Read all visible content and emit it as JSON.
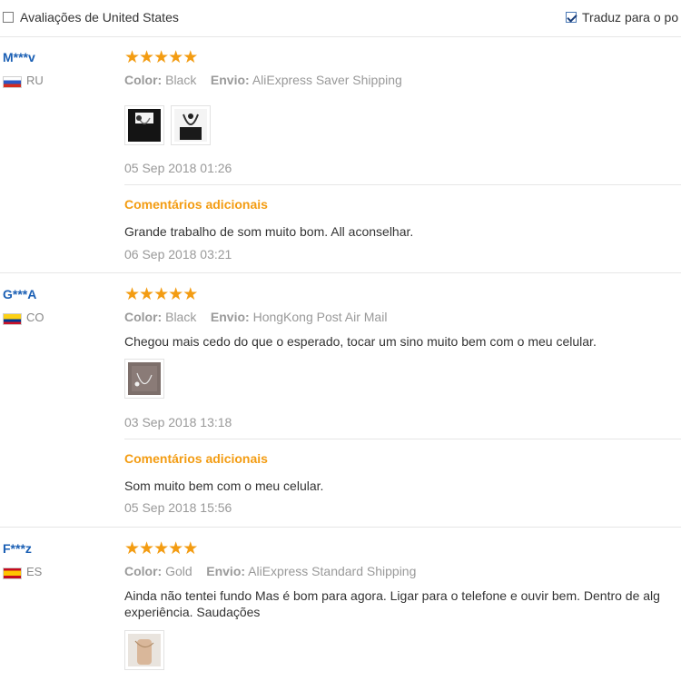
{
  "topbar": {
    "reviews_filter_label": "Avaliações de United States",
    "reviews_filter_checked": false,
    "translate_label": "Traduz para o po",
    "translate_checked": true
  },
  "reviews": [
    {
      "user": "M***v",
      "country": "RU",
      "flag": "russia-flag-icon",
      "stars": 5,
      "color_label": "Color:",
      "color_value": "Black",
      "shipping_label": "Envio:",
      "shipping_value": "AliExpress Saver Shipping",
      "text": "",
      "photos": [
        "review-photo-earphones-1",
        "review-photo-earphones-2"
      ],
      "date": "05 Sep 2018 01:26",
      "additional_heading": "Comentários adicionais",
      "additional_text": "Grande trabalho de som muito bom. All aconselhar.",
      "additional_date": "06 Sep 2018 03:21"
    },
    {
      "user": "G***A",
      "country": "CO",
      "flag": "colombia-flag-icon",
      "stars": 5,
      "color_label": "Color:",
      "color_value": "Black",
      "shipping_label": "Envio:",
      "shipping_value": "HongKong Post Air Mail",
      "text": "Chegou mais cedo do que o esperado, tocar um sino muito bem com o meu celular.",
      "photos": [
        "review-photo-earphones-3"
      ],
      "date": "03 Sep 2018 13:18",
      "additional_heading": "Comentários adicionais",
      "additional_text": "Som muito bem com o meu celular.",
      "additional_date": "05 Sep 2018 15:56"
    },
    {
      "user": "F***z",
      "country": "ES",
      "flag": "spain-flag-icon",
      "stars": 5,
      "color_label": "Color:",
      "color_value": "Gold",
      "shipping_label": "Envio:",
      "shipping_value": "AliExpress Standard Shipping",
      "text_line1": "Ainda não tentei fundo Mas é bom para agora. Ligar para o telefone e ouvir bem. Dentro de alg",
      "text_line2": "experiência. Saudações",
      "photos": [
        "review-photo-earphones-4"
      ]
    }
  ],
  "colors": {
    "star": "#f39c12",
    "username": "#1a5fb4",
    "additional_heading": "#f39c12",
    "muted": "#999999"
  }
}
